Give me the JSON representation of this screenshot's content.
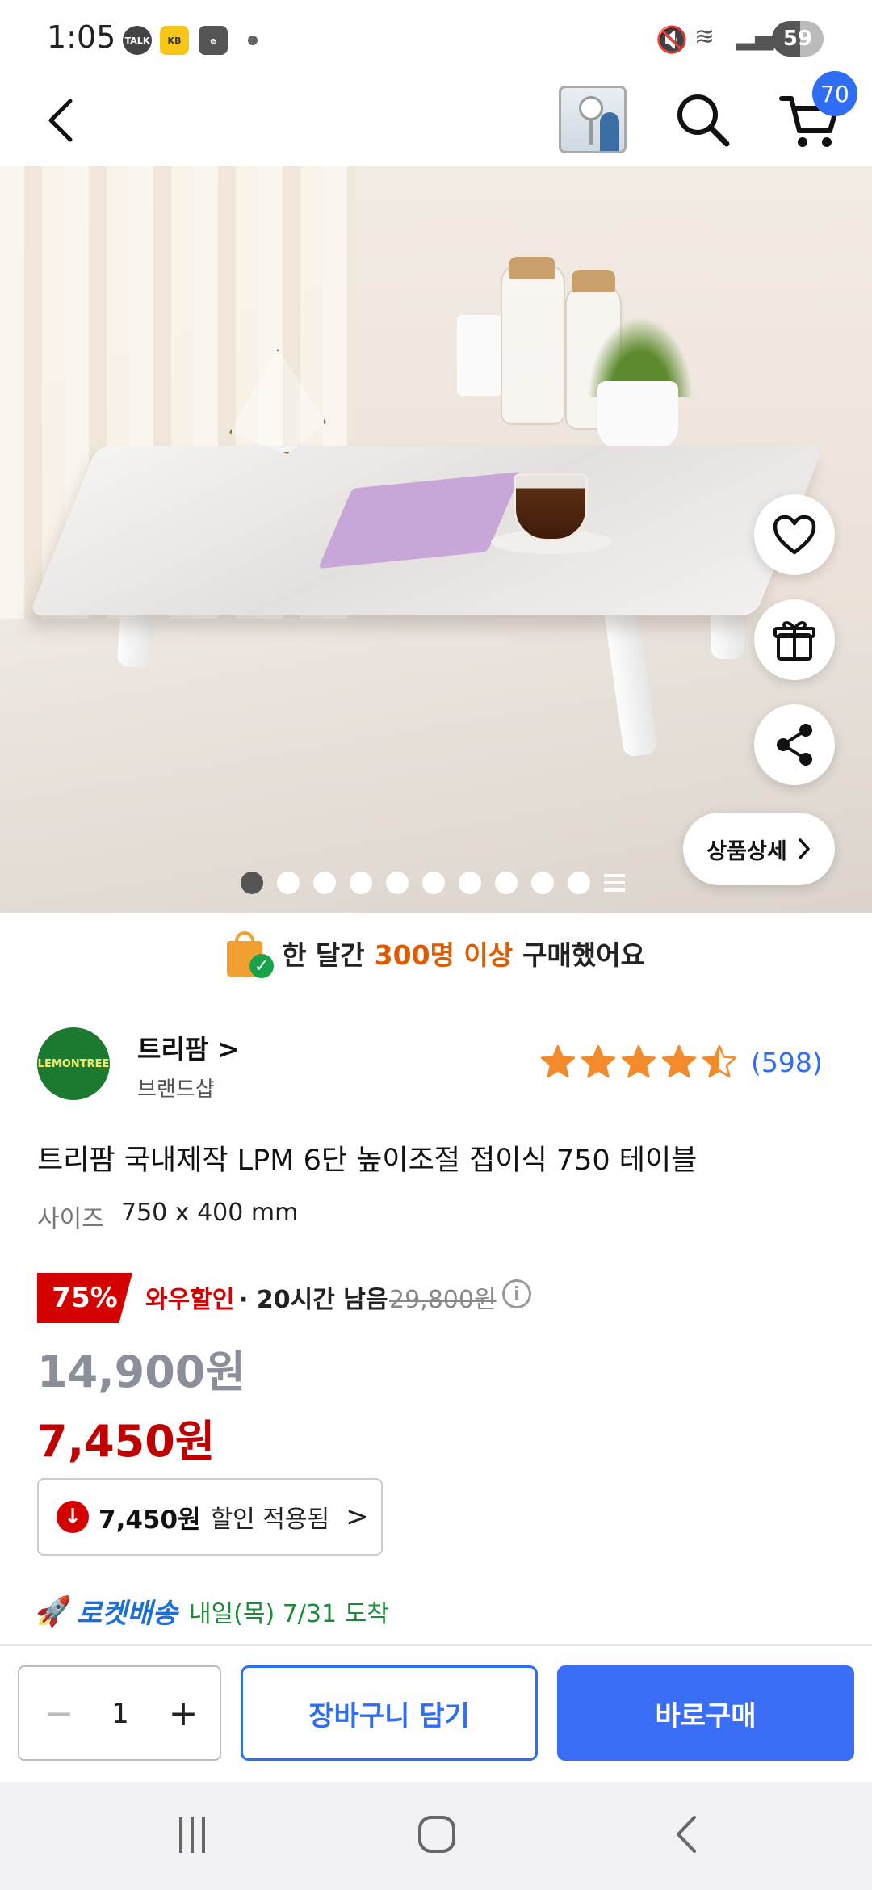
{
  "status_bar": {
    "time": "1:05",
    "talk_badge": "TALK",
    "kb_badge": "KB",
    "e_badge": "e",
    "battery": "59"
  },
  "header": {
    "cart_count": "70"
  },
  "gallery": {
    "dot_count": 10,
    "active_index": 0,
    "detail_label": "상품상세"
  },
  "purchase_banner": {
    "prefix": "한 달간",
    "highlight": "300명 이상",
    "suffix": "구매했어요"
  },
  "seller": {
    "logo_text": "LEMONTREE",
    "brand_name": "트리팜 >",
    "brand_sub": "브랜드샵",
    "rating": 4.5,
    "review_count": "(598)"
  },
  "product": {
    "title": "트리팜 국내제작 LPM 6단 높이조절 접이식 750 테이블",
    "size_label": "사이즈",
    "size_value": "750 x 400 mm"
  },
  "pricing": {
    "discount_badge": "75%",
    "wow_label": "와우할인",
    "remaining": "· 20시간 남음",
    "original_price": "29,800원",
    "info_icon": "i",
    "price_regular": "14,900원",
    "price_sale": "7,450원"
  },
  "coupon": {
    "amount": "7,450원",
    "text": "할인 적용됨",
    "chevron": ">"
  },
  "delivery": {
    "brand": "로켓배송",
    "text": "내일(목) 7/31 도착"
  },
  "action_bar": {
    "qty_minus": "−",
    "quantity": "1",
    "qty_plus": "+",
    "add_to_cart": "장바구니 담기",
    "buy_now": "바로구매"
  },
  "colors": {
    "accent_blue": "#2f6ef4",
    "sale_red": "#c00000",
    "rocket_blue": "#1d6fd8",
    "delivery_green": "#1c8a3a",
    "highlight_orange": "#e05a00"
  }
}
